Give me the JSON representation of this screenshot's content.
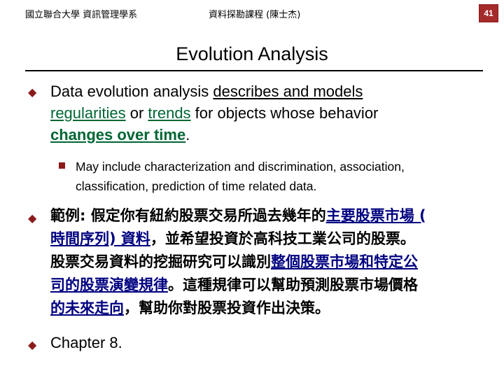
{
  "header": {
    "left": "國立聯合大學 資訊管理學系",
    "center": "資料探勘課程 (陳士杰)",
    "page_number": "41"
  },
  "slide": {
    "title": "Evolution Analysis",
    "bullet1": {
      "pre": "Data evolution analysis ",
      "term1": "describes and models",
      "term2": "regularities",
      "mid1": " or ",
      "term3": "trends",
      "mid2": " for objects whose behavior",
      "term4": "changes over time",
      "end": "."
    },
    "sub_bullet": {
      "line1": "May include characterization and discrimination, association,",
      "line2": "classification, prediction of time related data."
    },
    "bullet2": {
      "p1": "範例: 假定你有紐約股票交易所過去幾年的",
      "hl1": "主要股票市場 (",
      "hl1b": "時間序列) 資料",
      "p2": "，並希望投資於高科技工業公司的股票。",
      "p3": "股票交易資料的挖掘研究可以識別",
      "hl2": "整個股票市場和特定公",
      "hl2b": "司的股票演變規律",
      "p4": "。這種規律可以幫助預測股票市場價格",
      "hl3": "的未來走向",
      "p5": "，幫助你對股票投資作出決策。"
    },
    "bullet3": "Chapter 8."
  },
  "colors": {
    "accent": "#8b1a1a",
    "link_blue": "#000080",
    "term_green": "#006633"
  }
}
